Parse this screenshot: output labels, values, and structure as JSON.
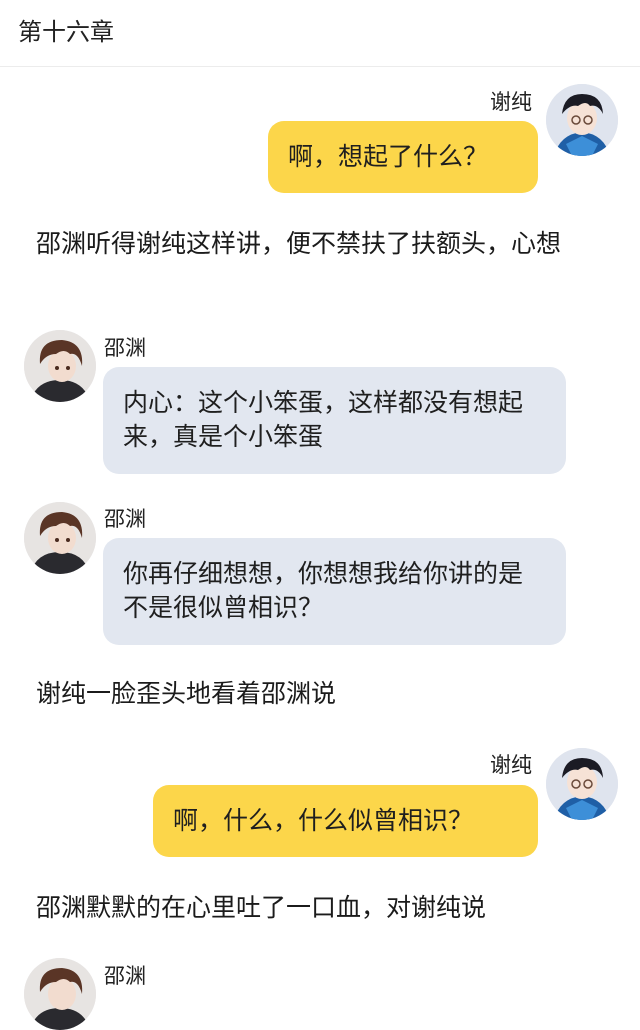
{
  "header": {
    "title": "第十六章"
  },
  "messages": [
    {
      "speaker": "谢纯",
      "text": "啊，想起了什么？"
    },
    {
      "narration": "邵渊听得谢纯这样讲，便不禁扶了扶额头，心想"
    },
    {
      "speaker": "邵渊",
      "text": "内心：这个小笨蛋，这样都没有想起来，真是个小笨蛋"
    },
    {
      "speaker": "邵渊",
      "text": "你再仔细想想，你想想我给你讲的是不是很似曾相识？"
    },
    {
      "narration": "谢纯一脸歪头地看着邵渊说"
    },
    {
      "speaker": "谢纯",
      "text": "啊，什么，什么似曾相识？"
    },
    {
      "narration": "邵渊默默的在心里吐了一口血，对谢纯说"
    },
    {
      "speaker": "邵渊",
      "text": ""
    }
  ],
  "colors": {
    "right_bubble": "#fcd64a",
    "left_bubble": "#e2e7f0"
  },
  "icons": {
    "xiechun": "avatar-xiechun-icon",
    "shaoyuan": "avatar-shaoyuan-icon"
  }
}
